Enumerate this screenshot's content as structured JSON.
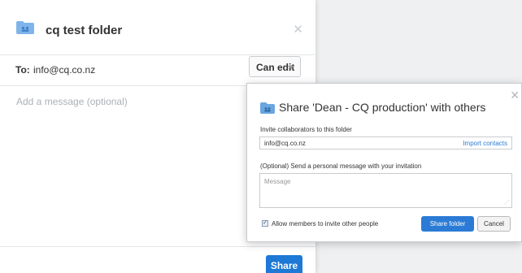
{
  "colors": {
    "accent": "#1d78d6",
    "folder": "#7fb4ea",
    "link": "#2b7bd6"
  },
  "back_dialog": {
    "title": "cq test folder",
    "close_icon": "close-icon",
    "to_label": "To:",
    "to_value": "info@cq.co.nz",
    "permission": "Can edit",
    "message_placeholder": "Add a message (optional)",
    "share_label": "Share"
  },
  "front_dialog": {
    "title": "Share 'Dean - CQ production' with others",
    "close_icon": "close-icon",
    "invite_label": "Invite collaborators to this folder",
    "invite_value": "info@cq.co.nz",
    "import_contacts": "Import contacts",
    "optional_label": "(Optional) Send a personal message with your invitation",
    "message_placeholder": "Message",
    "allow_label": "Allow members to invite other people",
    "allow_checked": true,
    "share_folder_label": "Share folder",
    "cancel_label": "Cancel"
  }
}
